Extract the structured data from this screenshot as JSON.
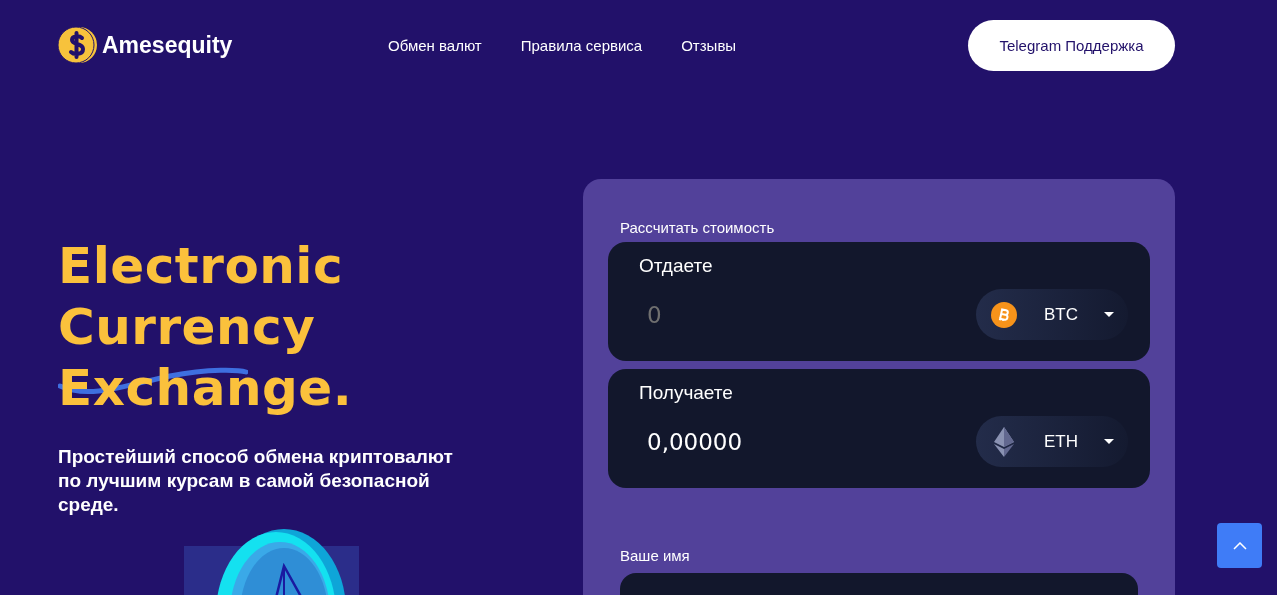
{
  "header": {
    "logo": "Amesequity",
    "nav": [
      "Обмен валют",
      "Правила сервиса",
      "Отзывы"
    ],
    "support_button": "Telegram Поддержка"
  },
  "hero": {
    "title_lines": [
      "Electronic",
      "Currency",
      "Exchange."
    ],
    "subtitle": "Простейший способ обмена криптовалют по лучшим курсам в самой безопасной среде."
  },
  "calculator": {
    "heading": "Рассчитать стоимость",
    "rows": [
      {
        "label": "Отдаете",
        "placeholder": "0",
        "currency": "BTC",
        "kind": "btc"
      },
      {
        "label": "Получаете",
        "value": "0,00000",
        "currency": "ETH",
        "kind": "eth"
      }
    ],
    "name_label": "Ваше имя"
  }
}
